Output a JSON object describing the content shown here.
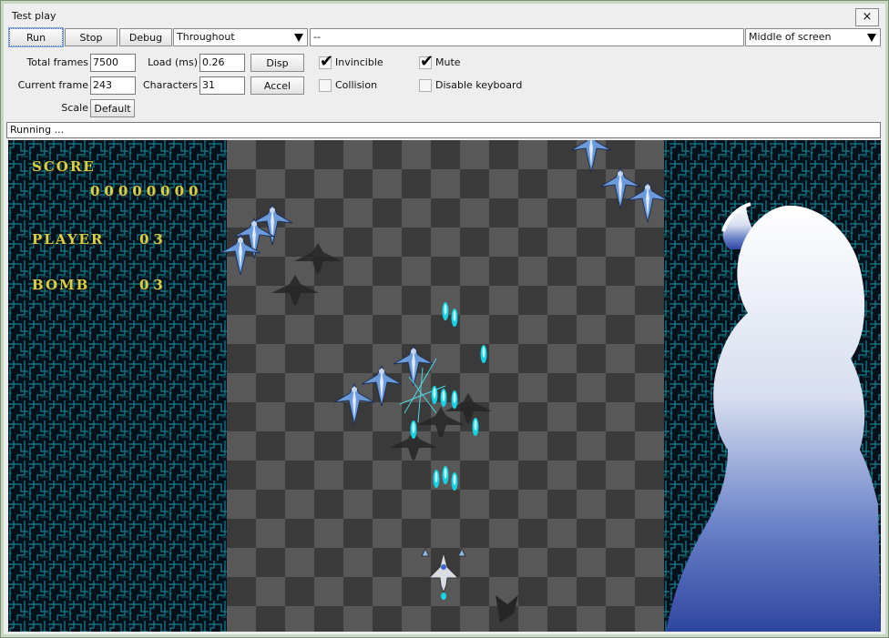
{
  "window": {
    "title": "Test play",
    "close_label": "×"
  },
  "toolbar": {
    "run_label": "Run",
    "stop_label": "Stop",
    "debug_label": "Debug",
    "range_select": "Throughout",
    "range_value": "--",
    "position_select": "Middle of screen"
  },
  "stats": {
    "total_frames_label": "Total frames",
    "total_frames_value": "7500",
    "current_frame_label": "Current frame",
    "current_frame_value": "243",
    "scale_label": "Scale",
    "scale_button": "Default",
    "load_label": "Load (ms)",
    "load_value": "0.26",
    "characters_label": "Characters",
    "characters_value": "31",
    "disp_button": "Disp",
    "accel_button": "Accel"
  },
  "options": {
    "invincible_label": "Invincible",
    "invincible_checked": true,
    "collision_label": "Collision",
    "collision_checked": false,
    "mute_label": "Mute",
    "mute_checked": true,
    "disable_keyboard_label": "Disable keyboard",
    "disable_keyboard_checked": false
  },
  "status": {
    "text": "Running ..."
  },
  "game": {
    "score_label": "SCORE",
    "score_value": "00000000",
    "player_label": "PLAYER",
    "player_value": "03",
    "bomb_label": "BOMB",
    "bomb_value": "03"
  },
  "colors": {
    "hud_text": "#d8d040",
    "grid_teal": "#1aa6b8",
    "bullet": "#19d6e6",
    "enemy": "#5b8fd0"
  }
}
